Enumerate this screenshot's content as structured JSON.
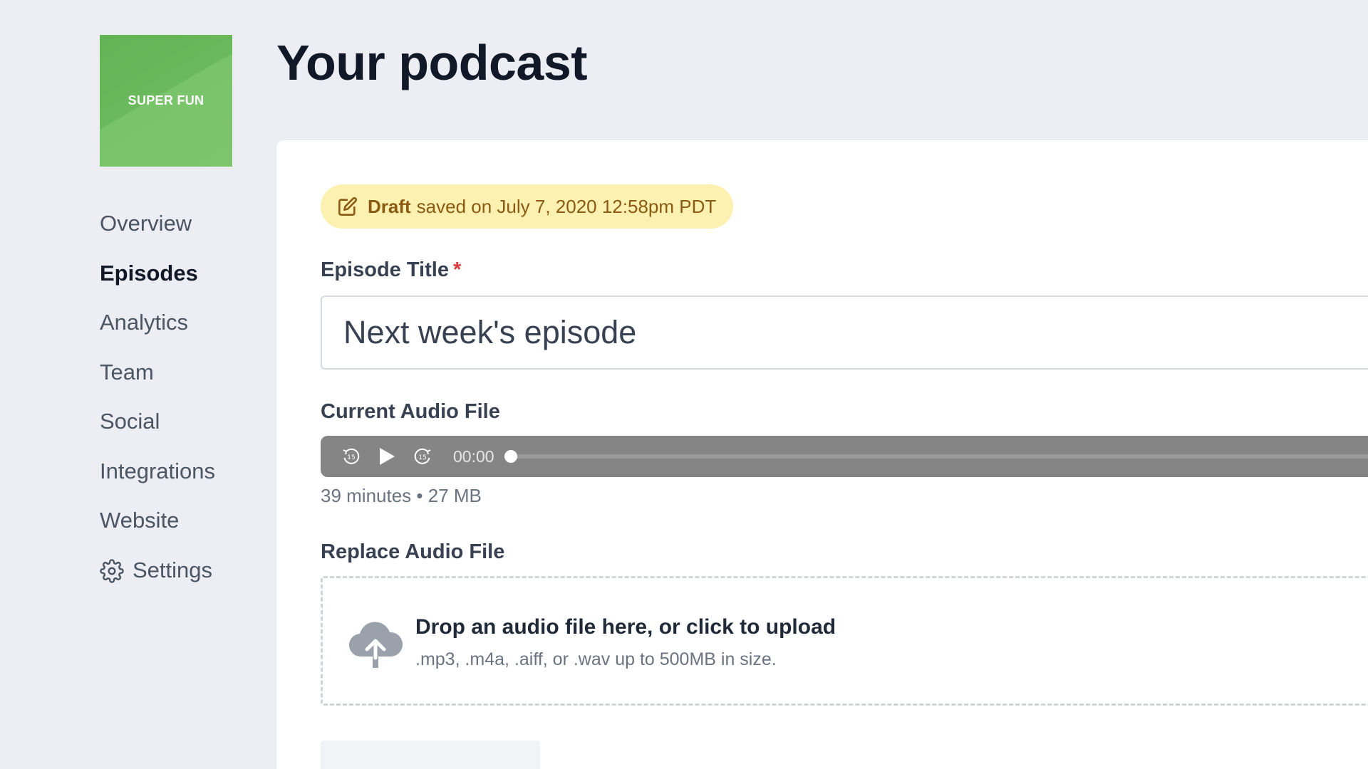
{
  "sidebar": {
    "cover_text": "SUPER FUN",
    "items": [
      {
        "label": "Overview"
      },
      {
        "label": "Episodes"
      },
      {
        "label": "Analytics"
      },
      {
        "label": "Team"
      },
      {
        "label": "Social"
      },
      {
        "label": "Integrations"
      },
      {
        "label": "Website"
      },
      {
        "label": "Settings",
        "icon": "gear-icon"
      }
    ],
    "active_item": "Episodes"
  },
  "header": {
    "title": "Your podcast"
  },
  "draft": {
    "status": "Draft",
    "text": "saved on July 7, 2020 12:58pm PDT",
    "icon": "edit-icon",
    "bg_color": "#fcf1b0",
    "text_color": "#8a5a12"
  },
  "episode_title": {
    "label": "Episode Title",
    "required_mark": "*",
    "value": "Next week's episode"
  },
  "audio": {
    "label": "Current Audio File",
    "time": "00:00",
    "progress": 0,
    "meta": "39 minutes • 27 MB",
    "controls": [
      "rewind-15-icon",
      "play-icon",
      "forward-15-icon"
    ]
  },
  "replace": {
    "label": "Replace Audio File",
    "title": "Drop an audio file here, or click to upload",
    "hint": ".mp3, .m4a, .aiff, or .wav up to 500MB in size.",
    "icon": "cloud-upload-icon"
  },
  "colors": {
    "cover": "#6ab95c",
    "required": "#dc3b3b",
    "player_bg": "#858585"
  }
}
